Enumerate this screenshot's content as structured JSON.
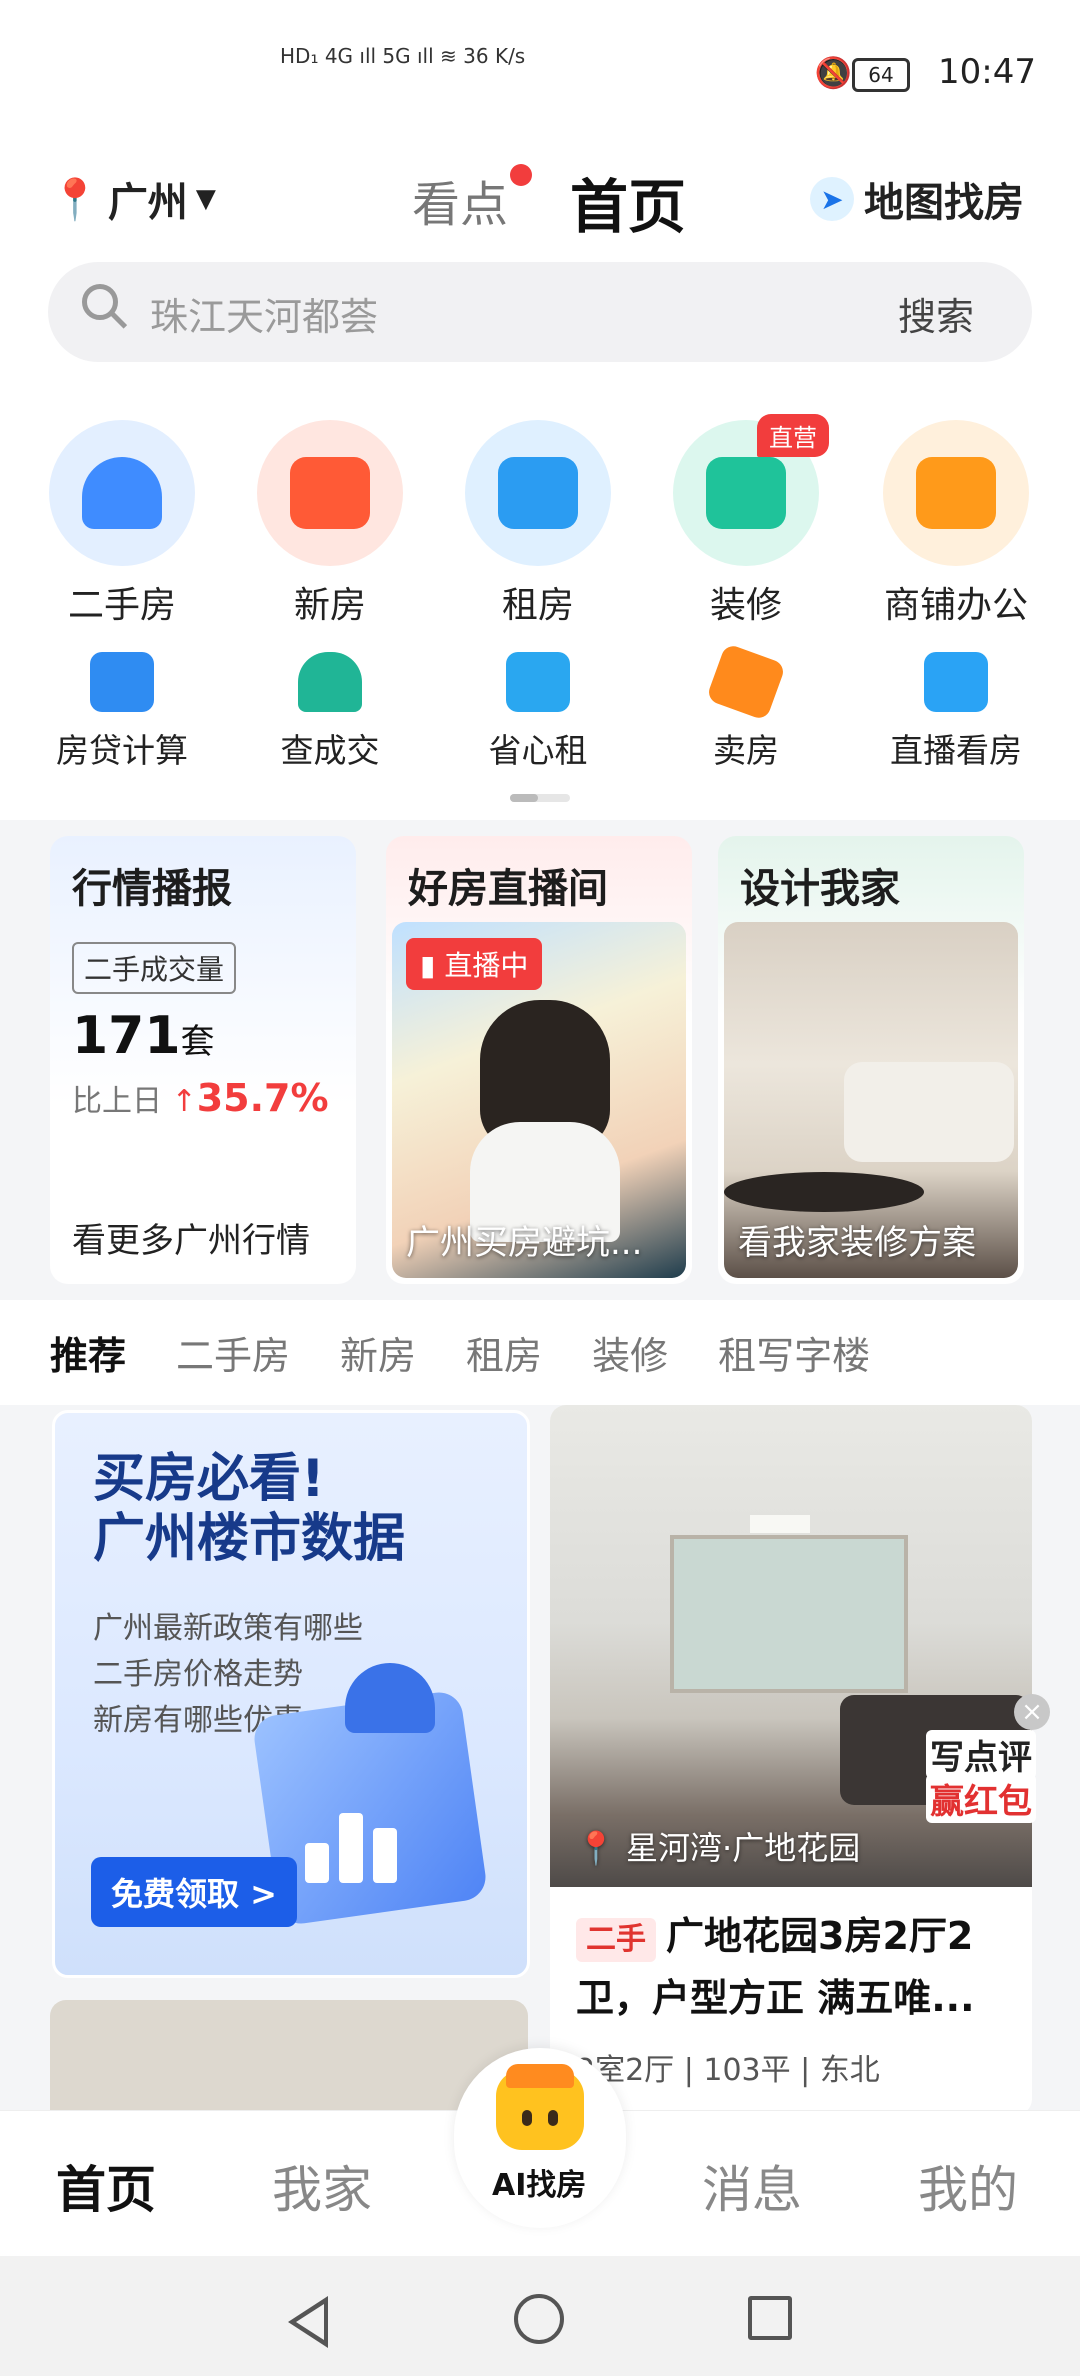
{
  "status_bar": {
    "left_text": "HD₁ 4G ıll 5G ıll ≋ 36 K/s",
    "battery": "64",
    "time": "10:47"
  },
  "header": {
    "city": "广州",
    "kandian": "看点",
    "title": "首页",
    "map_find": "地图找房"
  },
  "search": {
    "placeholder": "珠江天河都荟",
    "button": "搜索"
  },
  "big_grid": [
    {
      "label": "二手房",
      "icon": "house-icon",
      "color": "#3f8cff"
    },
    {
      "label": "新房",
      "icon": "building-icon",
      "color": "#ff5a36"
    },
    {
      "label": "租房",
      "icon": "sofa-icon",
      "color": "#2b9cf2"
    },
    {
      "label": "装修",
      "icon": "armchair-icon",
      "color": "#1fc39a",
      "badge": "直营"
    },
    {
      "label": "商铺办公",
      "icon": "shop-icon",
      "color": "#ff9a1a"
    }
  ],
  "small_grid": [
    {
      "label": "房贷计算",
      "icon": "calculator-icon",
      "color": "#2f8cf2"
    },
    {
      "label": "查成交",
      "icon": "stamp-icon",
      "color": "#20b596"
    },
    {
      "label": "省心租",
      "icon": "check-icon",
      "color": "#2aa7f0"
    },
    {
      "label": "卖房",
      "icon": "tag-icon",
      "color": "#ff8a1c"
    },
    {
      "label": "直播看房",
      "icon": "tv-play-icon",
      "color": "#2aa3f5"
    }
  ],
  "cards": {
    "market": {
      "title": "行情播报",
      "badge": "二手成交量",
      "value": "171",
      "unit": "套",
      "compare_label": "比上日",
      "compare_value": "35.7%",
      "footer": "看更多广州行情"
    },
    "live": {
      "title": "好房直播间",
      "live_tag": "直播中",
      "caption": "广州买房避坑..."
    },
    "design": {
      "title": "设计我家",
      "caption": "看我家装修方案"
    }
  },
  "tabs": [
    "推荐",
    "二手房",
    "新房",
    "租房",
    "装修",
    "租写字楼"
  ],
  "promo": {
    "title_line1": "买房必看!",
    "title_line2": "广州楼市数据",
    "lines": [
      "广州最新政策有哪些",
      "二手房价格走势",
      "新房有哪些优惠"
    ],
    "button": "免费领取 >"
  },
  "listing": {
    "location": "星河湾·广地花园",
    "tag": "二手",
    "title": "广地花园3房2厅2卫，户型方正 满五唯...",
    "meta": "2室2厅 | 103平 | 东北"
  },
  "floater": {
    "line1": "写点评",
    "line2": "赢红包"
  },
  "bottom_nav": {
    "home": "首页",
    "myhome": "我家",
    "ai": "AI找房",
    "messages": "消息",
    "mine": "我的"
  }
}
